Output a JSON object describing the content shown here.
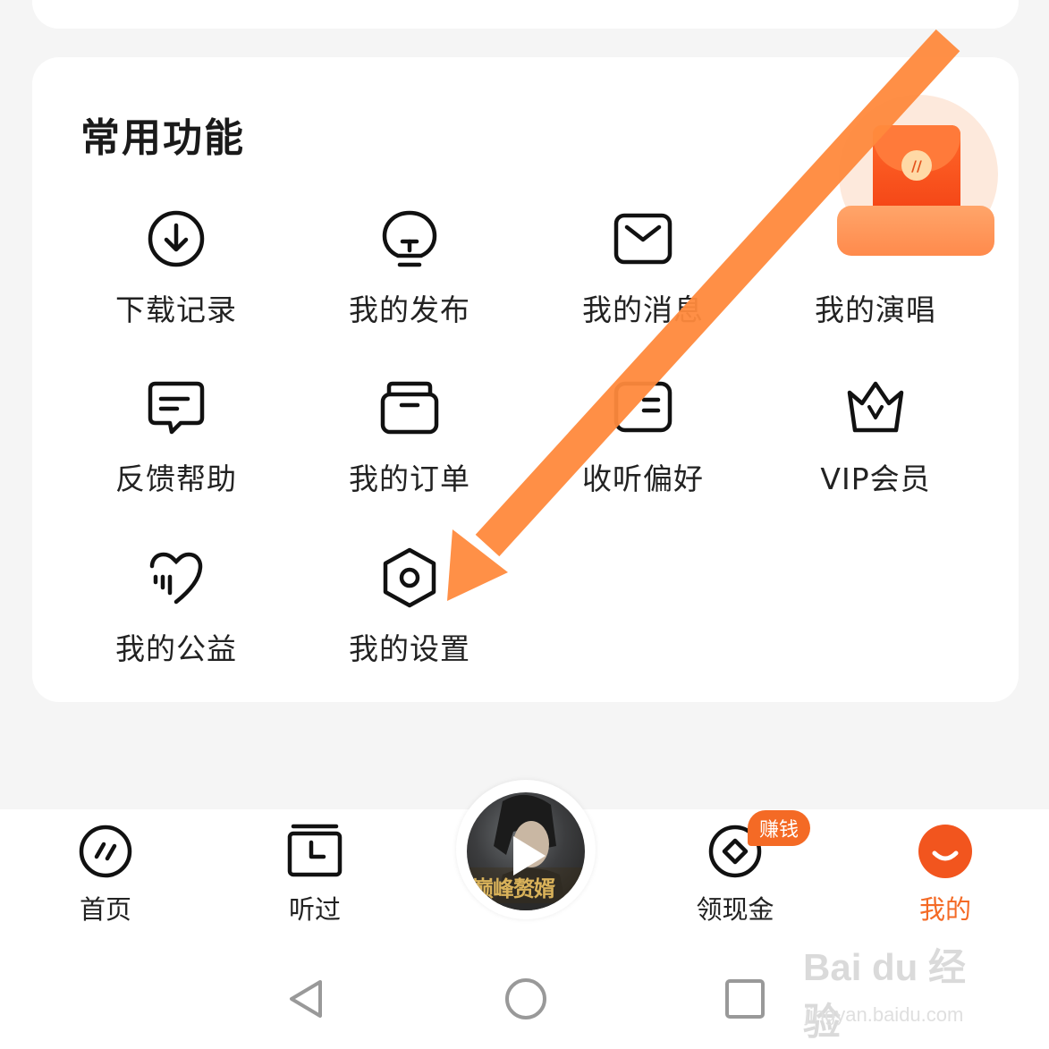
{
  "section": {
    "title": "常用功能"
  },
  "features": [
    {
      "label": "下载记录",
      "icon": "download-icon"
    },
    {
      "label": "我的发布",
      "icon": "publish-bulb-icon"
    },
    {
      "label": "我的消息",
      "icon": "message-envelope-icon"
    },
    {
      "label": "我的演唱",
      "icon": "sing-icon"
    },
    {
      "label": "反馈帮助",
      "icon": "feedback-chat-icon"
    },
    {
      "label": "我的订单",
      "icon": "order-box-icon"
    },
    {
      "label": "收听偏好",
      "icon": "listen-preference-icon"
    },
    {
      "label": "VIP会员",
      "icon": "vip-crown-icon"
    },
    {
      "label": "我的公益",
      "icon": "charity-heart-icon"
    },
    {
      "label": "我的设置",
      "icon": "settings-hexagon-icon"
    }
  ],
  "tabbar": {
    "items": [
      {
        "label": "首页",
        "icon": "home-icon"
      },
      {
        "label": "听过",
        "icon": "history-icon"
      },
      {
        "label": "领现金",
        "icon": "cash-coin-icon"
      },
      {
        "label": "我的",
        "icon": "profile-smile-icon"
      }
    ],
    "earn_badge": "赚钱"
  },
  "player": {
    "cover_text": "巅峰赘婿"
  },
  "watermark": {
    "brand": "Bai du 经验",
    "url": "jingyan.baidu.com"
  },
  "colors": {
    "accent": "#f46a25",
    "arrow": "#ff8a3d",
    "card": "#ffffff",
    "background": "#f5f5f5"
  }
}
